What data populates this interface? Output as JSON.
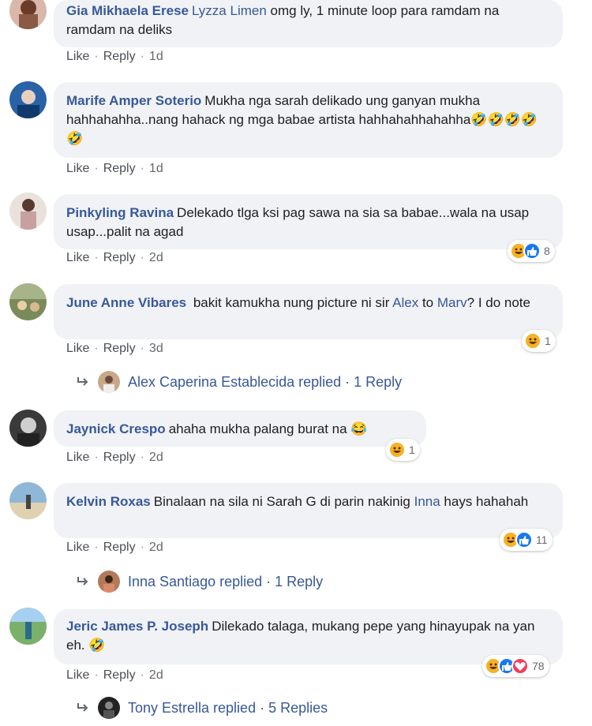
{
  "comments": [
    {
      "author": "Gia Mikhaela Erese",
      "segments": [
        {
          "type": "mention",
          "text": "Lyzza Limen"
        },
        {
          "type": "text",
          "text": " omg ly, 1 minute loop para ramdam na ramdam na deliks"
        }
      ],
      "like": "Like",
      "reply": "Reply",
      "age": "1d"
    },
    {
      "author": "Marife Amper Soterio",
      "segments": [
        {
          "type": "text",
          "text": "Mukha nga sarah delikado ung ganyan mukha hahhahahha..nang hahack ng mga babae artista hahhahahhahahha🤣🤣🤣🤣🤣"
        }
      ],
      "like": "Like",
      "reply": "Reply",
      "age": "1d"
    },
    {
      "author": "Pinkyling Ravina",
      "segments": [
        {
          "type": "text",
          "text": "Delekado tlga ksi pag sawa na sia sa babae...wala na usap usap...palit na agad"
        }
      ],
      "like": "Like",
      "reply": "Reply",
      "age": "2d",
      "reaction_count": "8"
    },
    {
      "author": "June Anne Vibares",
      "segments": [
        {
          "type": "text",
          "text": " bakit kamukha nung picture ni sir "
        },
        {
          "type": "mention",
          "text": "Alex"
        },
        {
          "type": "text",
          "text": " to "
        },
        {
          "type": "mention",
          "text": "Marv"
        },
        {
          "type": "text",
          "text": "? I do note"
        }
      ],
      "like": "Like",
      "reply": "Reply",
      "age": "3d",
      "reaction_count": "1",
      "replies": "Alex Caperina Establecida replied · 1 Reply"
    },
    {
      "author": "Jaynick Crespo",
      "segments": [
        {
          "type": "text",
          "text": "ahaha mukha palang burat na 😂"
        }
      ],
      "like": "Like",
      "reply": "Reply",
      "age": "2d",
      "reaction_count": "1"
    },
    {
      "author": "Kelvin Roxas",
      "segments": [
        {
          "type": "text",
          "text": "Binalaan na sila ni Sarah G di parin nakinig "
        },
        {
          "type": "mention",
          "text": "Inna"
        },
        {
          "type": "text",
          "text": " hays hahahah"
        }
      ],
      "like": "Like",
      "reply": "Reply",
      "age": "2d",
      "reaction_count": "11",
      "replies": "Inna Santiago replied · 1 Reply"
    },
    {
      "author": "Jeric James P. Joseph",
      "segments": [
        {
          "type": "text",
          "text": "Dilekado talaga, mukang pepe yang hinayupak na yan eh. 🤣"
        }
      ],
      "like": "Like",
      "reply": "Reply",
      "age": "2d",
      "reaction_count": "78",
      "replies": "Tony Estrella replied · 5 Replies"
    }
  ],
  "colors": {
    "author": "#385898",
    "bubble": "#f0f2f5",
    "meta": "#65676b",
    "haha": "#f7b125",
    "like": "#1877f2",
    "love": "#f33e58"
  },
  "icons": [
    "haha-reaction-icon",
    "like-reaction-icon",
    "love-reaction-icon",
    "reply-arrow-icon"
  ]
}
